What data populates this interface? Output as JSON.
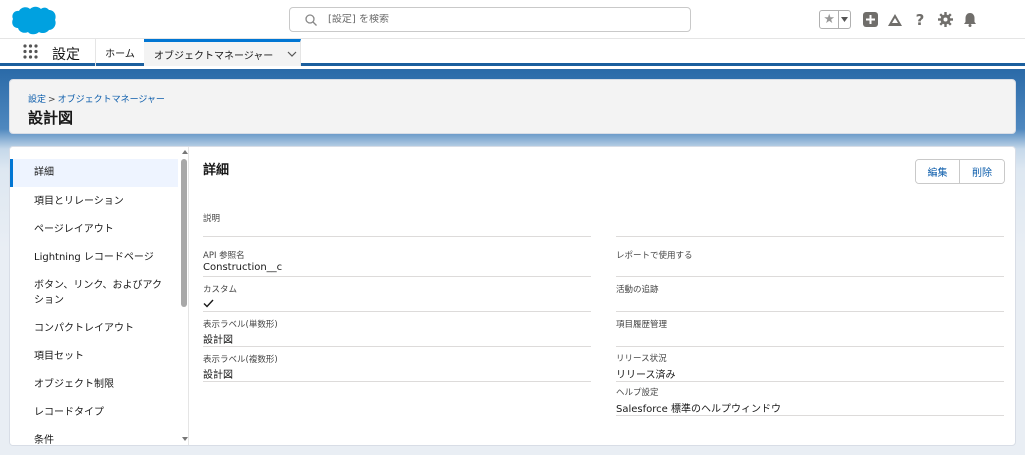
{
  "header": {
    "search_placeholder": "[設定] を検索",
    "icons": [
      "salesforce-cloud-logo",
      "search-icon",
      "favorites-star-icon",
      "chevron-down-icon",
      "add-icon",
      "trailhead-icon",
      "help-icon",
      "gear-icon",
      "bell-icon"
    ],
    "brand_color": "#00a1e0"
  },
  "appnav": {
    "app_name": "設定",
    "tabs": [
      {
        "label": "ホーム"
      },
      {
        "label": "オブジェクトマネージャー"
      }
    ]
  },
  "page_header": {
    "breadcrumb": [
      "設定",
      "オブジェクトマネージャー"
    ],
    "breadcrumb_separator": ">",
    "title": "設計図"
  },
  "sidebar": {
    "items": [
      {
        "label": "詳細"
      },
      {
        "label": "項目とリレーション"
      },
      {
        "label": "ページレイアウト"
      },
      {
        "label": "Lightning レコードページ"
      },
      {
        "label": "ボタン、リンク、およびアクション"
      },
      {
        "label": "コンパクトレイアウト"
      },
      {
        "label": "項目セット"
      },
      {
        "label": "オブジェクト制限"
      },
      {
        "label": "レコードタイプ"
      },
      {
        "label": "条件"
      }
    ]
  },
  "detail": {
    "title": "詳細",
    "buttons": {
      "edit": "編集",
      "delete": "削除"
    },
    "fields_left": [
      {
        "label": "説明",
        "value": ""
      },
      {
        "label": "API 参照名",
        "value": "Construction__c"
      },
      {
        "label": "カスタム",
        "value": ""
      },
      {
        "label": "表示ラベル(単数形)",
        "value": "設計図"
      },
      {
        "label": "表示ラベル(複数形)",
        "value": "設計図"
      }
    ],
    "fields_right": [
      {
        "label": "レポートで使用する",
        "value": ""
      },
      {
        "label": "活動の追跡",
        "value": ""
      },
      {
        "label": "項目履歴管理",
        "value": ""
      },
      {
        "label": "リリース状況",
        "value": "リリース済み"
      },
      {
        "label": "ヘルプ設定",
        "value": "Salesforce 標準のヘルプウィンドウ"
      }
    ],
    "custom_checked": true
  }
}
